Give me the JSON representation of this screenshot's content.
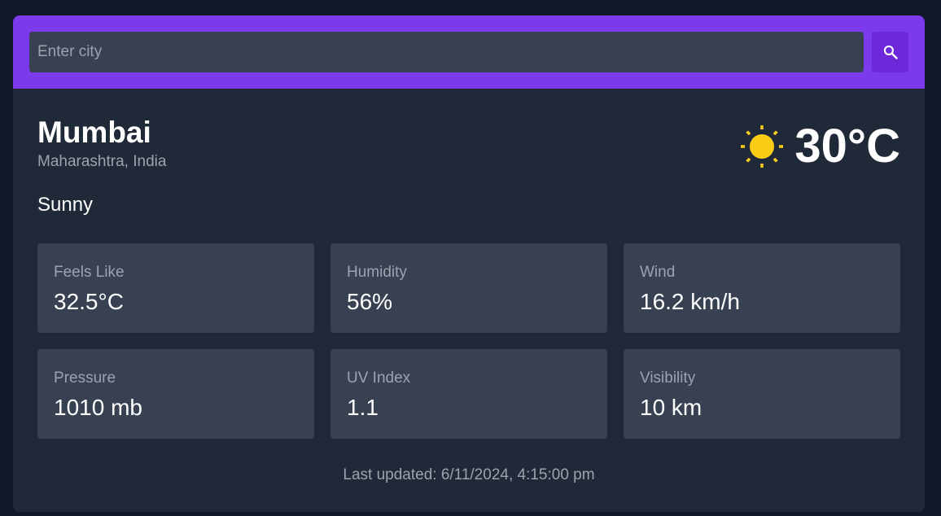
{
  "search": {
    "placeholder": "Enter city",
    "value": "",
    "button_icon": "search-icon"
  },
  "location": {
    "city": "Mumbai",
    "region": "Maharashtra, India"
  },
  "current": {
    "icon": "sun-icon",
    "temperature": "30°C",
    "condition": "Sunny"
  },
  "stats": [
    {
      "label": "Feels Like",
      "value": "32.5°C"
    },
    {
      "label": "Humidity",
      "value": "56%"
    },
    {
      "label": "Wind",
      "value": "16.2 km/h"
    },
    {
      "label": "Pressure",
      "value": "1010 mb"
    },
    {
      "label": "UV Index",
      "value": "1.1"
    },
    {
      "label": "Visibility",
      "value": "10 km"
    }
  ],
  "footer": {
    "last_updated": "Last updated: 6/11/2024, 4:15:00 pm"
  },
  "colors": {
    "header": "#7c3aed",
    "card": "#1f2937",
    "tile": "#374151",
    "sun": "#facc15"
  }
}
